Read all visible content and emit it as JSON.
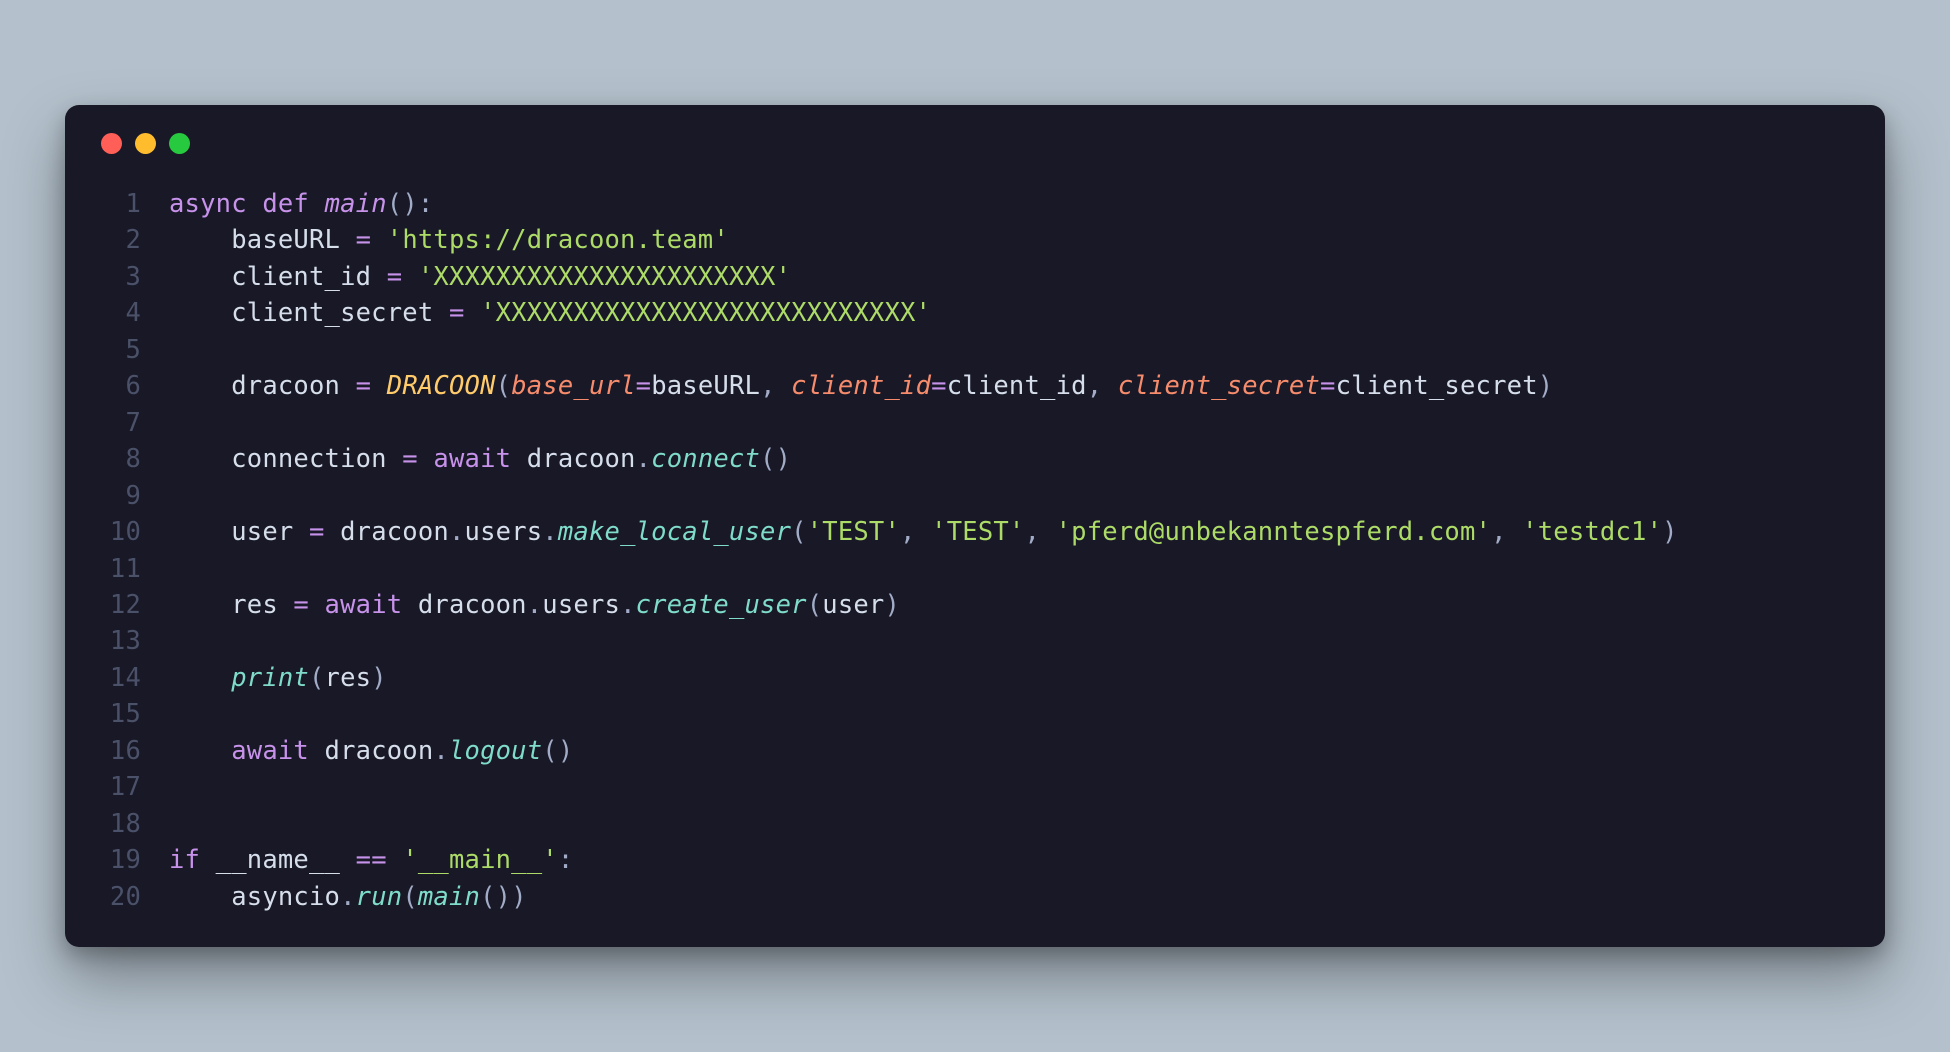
{
  "window": {
    "traffic_lights": [
      "red",
      "yellow",
      "green"
    ]
  },
  "colors": {
    "bg_page": "#b4c1cc",
    "bg_window": "#181827",
    "gutter": "#4a5168",
    "keyword": "#c792ea",
    "class": "#ffcb6b",
    "default": "#d6deeb",
    "punct": "#a2acc7",
    "string": "#addb67",
    "kwarg": "#f78c6c",
    "call": "#7fdbca"
  },
  "code": {
    "language": "python",
    "line_numbers": [
      "1",
      "2",
      "3",
      "4",
      "5",
      "6",
      "7",
      "8",
      "9",
      "10",
      "11",
      "12",
      "13",
      "14",
      "15",
      "16",
      "17",
      "18",
      "19",
      "20"
    ],
    "lines": [
      [
        {
          "t": "async",
          "c": "kw"
        },
        {
          "t": " ",
          "c": "var"
        },
        {
          "t": "def",
          "c": "kw"
        },
        {
          "t": " ",
          "c": "var"
        },
        {
          "t": "main",
          "c": "fn-i"
        },
        {
          "t": "():",
          "c": "pun"
        }
      ],
      [
        {
          "t": "    baseURL ",
          "c": "var"
        },
        {
          "t": "=",
          "c": "op"
        },
        {
          "t": " ",
          "c": "var"
        },
        {
          "t": "'https://dracoon.team'",
          "c": "str"
        }
      ],
      [
        {
          "t": "    client_id ",
          "c": "var"
        },
        {
          "t": "=",
          "c": "op"
        },
        {
          "t": " ",
          "c": "var"
        },
        {
          "t": "'XXXXXXXXXXXXXXXXXXXXXX'",
          "c": "str"
        }
      ],
      [
        {
          "t": "    client_secret ",
          "c": "var"
        },
        {
          "t": "=",
          "c": "op"
        },
        {
          "t": " ",
          "c": "var"
        },
        {
          "t": "'XXXXXXXXXXXXXXXXXXXXXXXXXXX'",
          "c": "str"
        }
      ],
      [],
      [
        {
          "t": "    dracoon ",
          "c": "var"
        },
        {
          "t": "=",
          "c": "op"
        },
        {
          "t": " ",
          "c": "var"
        },
        {
          "t": "DRACOON",
          "c": "cls"
        },
        {
          "t": "(",
          "c": "pun"
        },
        {
          "t": "base_url",
          "c": "kwa"
        },
        {
          "t": "=",
          "c": "op"
        },
        {
          "t": "baseURL",
          "c": "var"
        },
        {
          "t": ", ",
          "c": "pun"
        },
        {
          "t": "client_id",
          "c": "kwa"
        },
        {
          "t": "=",
          "c": "op"
        },
        {
          "t": "client_id",
          "c": "var"
        },
        {
          "t": ", ",
          "c": "pun"
        },
        {
          "t": "client_secret",
          "c": "kwa"
        },
        {
          "t": "=",
          "c": "op"
        },
        {
          "t": "client_secret",
          "c": "var"
        },
        {
          "t": ")",
          "c": "pun"
        }
      ],
      [],
      [
        {
          "t": "    connection ",
          "c": "var"
        },
        {
          "t": "=",
          "c": "op"
        },
        {
          "t": " ",
          "c": "var"
        },
        {
          "t": "await",
          "c": "kw"
        },
        {
          "t": " dracoon",
          "c": "var"
        },
        {
          "t": ".",
          "c": "pun"
        },
        {
          "t": "connect",
          "c": "call"
        },
        {
          "t": "()",
          "c": "pun"
        }
      ],
      [],
      [
        {
          "t": "    user ",
          "c": "var"
        },
        {
          "t": "=",
          "c": "op"
        },
        {
          "t": " dracoon",
          "c": "var"
        },
        {
          "t": ".",
          "c": "pun"
        },
        {
          "t": "users",
          "c": "prop"
        },
        {
          "t": ".",
          "c": "pun"
        },
        {
          "t": "make_local_user",
          "c": "call"
        },
        {
          "t": "(",
          "c": "pun"
        },
        {
          "t": "'TEST'",
          "c": "str"
        },
        {
          "t": ", ",
          "c": "pun"
        },
        {
          "t": "'TEST'",
          "c": "str"
        },
        {
          "t": ", ",
          "c": "pun"
        },
        {
          "t": "'pferd@unbekanntespferd.com'",
          "c": "str"
        },
        {
          "t": ", ",
          "c": "pun"
        },
        {
          "t": "'testdc1'",
          "c": "str"
        },
        {
          "t": ")",
          "c": "pun"
        }
      ],
      [],
      [
        {
          "t": "    res ",
          "c": "var"
        },
        {
          "t": "=",
          "c": "op"
        },
        {
          "t": " ",
          "c": "var"
        },
        {
          "t": "await",
          "c": "kw"
        },
        {
          "t": " dracoon",
          "c": "var"
        },
        {
          "t": ".",
          "c": "pun"
        },
        {
          "t": "users",
          "c": "prop"
        },
        {
          "t": ".",
          "c": "pun"
        },
        {
          "t": "create_user",
          "c": "call"
        },
        {
          "t": "(",
          "c": "pun"
        },
        {
          "t": "user",
          "c": "var"
        },
        {
          "t": ")",
          "c": "pun"
        }
      ],
      [],
      [
        {
          "t": "    ",
          "c": "var"
        },
        {
          "t": "print",
          "c": "call"
        },
        {
          "t": "(",
          "c": "pun"
        },
        {
          "t": "res",
          "c": "var"
        },
        {
          "t": ")",
          "c": "pun"
        }
      ],
      [],
      [
        {
          "t": "    ",
          "c": "var"
        },
        {
          "t": "await",
          "c": "kw"
        },
        {
          "t": " dracoon",
          "c": "var"
        },
        {
          "t": ".",
          "c": "pun"
        },
        {
          "t": "logout",
          "c": "call"
        },
        {
          "t": "()",
          "c": "pun"
        }
      ],
      [],
      [],
      [
        {
          "t": "if",
          "c": "kw"
        },
        {
          "t": " __name__ ",
          "c": "var"
        },
        {
          "t": "==",
          "c": "op"
        },
        {
          "t": " ",
          "c": "var"
        },
        {
          "t": "'__main__'",
          "c": "str"
        },
        {
          "t": ":",
          "c": "pun"
        }
      ],
      [
        {
          "t": "    asyncio",
          "c": "var"
        },
        {
          "t": ".",
          "c": "pun"
        },
        {
          "t": "run",
          "c": "call"
        },
        {
          "t": "(",
          "c": "pun"
        },
        {
          "t": "main",
          "c": "call"
        },
        {
          "t": "())",
          "c": "pun"
        }
      ]
    ]
  }
}
